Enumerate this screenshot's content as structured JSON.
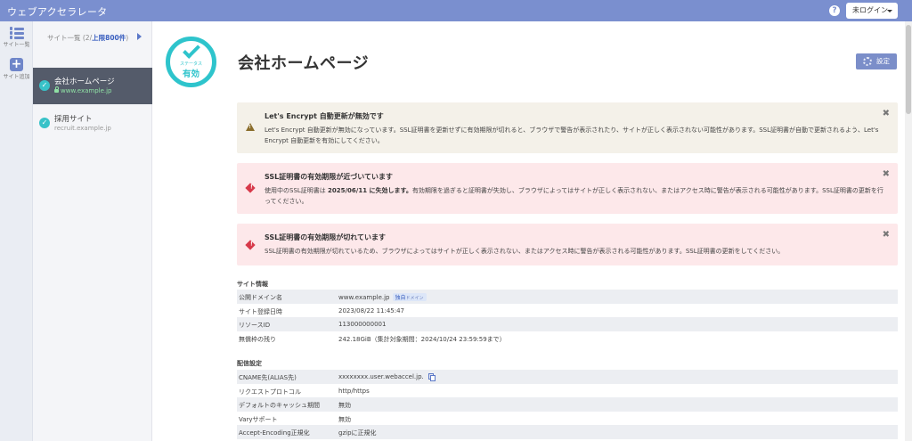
{
  "header": {
    "brand": "ウェブアクセラレータ",
    "help": "?",
    "login_label": "未ログイン"
  },
  "rail": {
    "items": [
      {
        "icon": "list-icon",
        "label": "サイト一覧"
      },
      {
        "icon": "plus-icon",
        "label": "サイト追加"
      }
    ]
  },
  "sites": {
    "heading_prefix": "サイト一覧 (2/",
    "heading_limit": "上限800件",
    "heading_suffix": ")",
    "items": [
      {
        "name": "会社ホームページ",
        "domain": "www.example.jp",
        "active": true
      },
      {
        "name": "採用サイト",
        "domain": "recruit.example.jp",
        "active": false
      }
    ]
  },
  "main": {
    "status_badge": {
      "label_small": "ステータス",
      "label_large": "有効"
    },
    "title": "会社ホームページ",
    "settings_label": "設定",
    "alerts": [
      {
        "kind": "warning",
        "title": "Let's Encrypt 自動更新が無効です",
        "body": "Let's Encrypt 自動更新が無効になっています。SSL証明書を更新せずに有効期限が切れると、ブラウザで警告が表示されたり、サイトが正しく表示されない可能性があります。SSL証明書が自動で更新されるよう、Let's Encrypt 自動更新を有効にしてください。",
        "close": "✖"
      },
      {
        "kind": "error",
        "title": "SSL証明書の有効期限が近づいています",
        "body_pre": "使用中のSSL証明書は ",
        "body_bold": "2025/06/11 に失効します。",
        "body_post": "有効期限を過ぎると証明書が失効し、ブラウザによってはサイトが正しく表示されない、またはアクセス時に警告が表示される可能性があります。SSL証明書の更新を行ってください。",
        "close": "✖"
      },
      {
        "kind": "error",
        "title": "SSL証明書の有効期限が切れています",
        "body": "SSL証明書の有効期限が切れているため、ブラウザによってはサイトが正しく表示されない、またはアクセス時に警告が表示される可能性があります。SSL証明書の更新をしてください。",
        "close": "✖"
      }
    ],
    "site_info": {
      "title": "サイト情報",
      "rows": [
        {
          "key": "公開ドメイン名",
          "value": "www.example.jp",
          "tag": "独自",
          "tag_sub": "ドメイン"
        },
        {
          "key": "サイト登録日時",
          "value": "2023/08/22 11:45:47"
        },
        {
          "key": "リソースID",
          "value": "113000000001"
        },
        {
          "key": "無償枠の残り",
          "value": "242.18GiB（集計対象期間：2024/10/24 23:59:59まで）"
        }
      ]
    },
    "delivery": {
      "title": "配信設定",
      "rows": [
        {
          "key": "CNAME先(ALIAS先)",
          "value": "xxxxxxxx.user.webaccel.jp."
        },
        {
          "key": "リクエストプロトコル",
          "value": "http/https"
        },
        {
          "key": "デフォルトのキャッシュ期間",
          "value": "無効"
        },
        {
          "key": "Varyサポート",
          "value": "無効"
        },
        {
          "key": "Accept-Encoding正規化",
          "value": "gzipに正規化"
        }
      ]
    }
  }
}
